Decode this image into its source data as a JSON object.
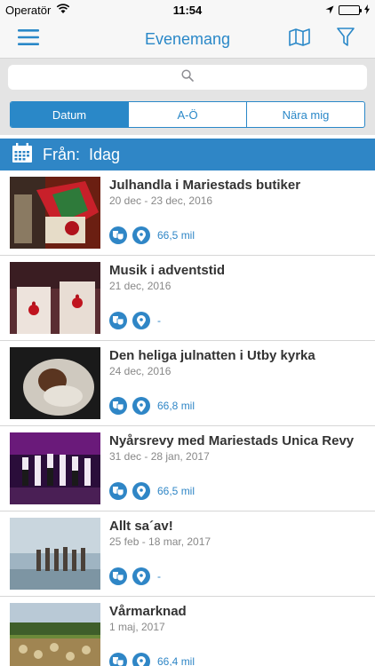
{
  "status_bar": {
    "carrier": "Operatör",
    "time": "11:54"
  },
  "nav": {
    "title": "Evenemang"
  },
  "search": {
    "placeholder": ""
  },
  "segments": [
    {
      "label": "Datum",
      "active": true
    },
    {
      "label": "A-Ö",
      "active": false
    },
    {
      "label": "Nära mig",
      "active": false
    }
  ],
  "date_filter": {
    "label": "Från:",
    "value": "Idag"
  },
  "events": [
    {
      "title": "Julhandla i Mariestads butiker",
      "date": "20 dec - 23 dec, 2016",
      "distance": "66,5 mil"
    },
    {
      "title": "Musik i adventstid",
      "date": "21 dec, 2016",
      "distance": "-"
    },
    {
      "title": "Den heliga julnatten i Utby kyrka",
      "date": "24 dec, 2016",
      "distance": "66,8 mil"
    },
    {
      "title": "Nyårsrevy med Mariestads Unica Revy",
      "date": "31 dec - 28 jan, 2017",
      "distance": "66,5 mil"
    },
    {
      "title": "Allt sa´av!",
      "date": "25 feb - 18 mar, 2017",
      "distance": "-"
    },
    {
      "title": "Vårmarknad",
      "date": "1 maj, 2017",
      "distance": "66,4 mil"
    }
  ],
  "colors": {
    "accent": "#2a88c8",
    "datebar": "#2f86c6"
  }
}
